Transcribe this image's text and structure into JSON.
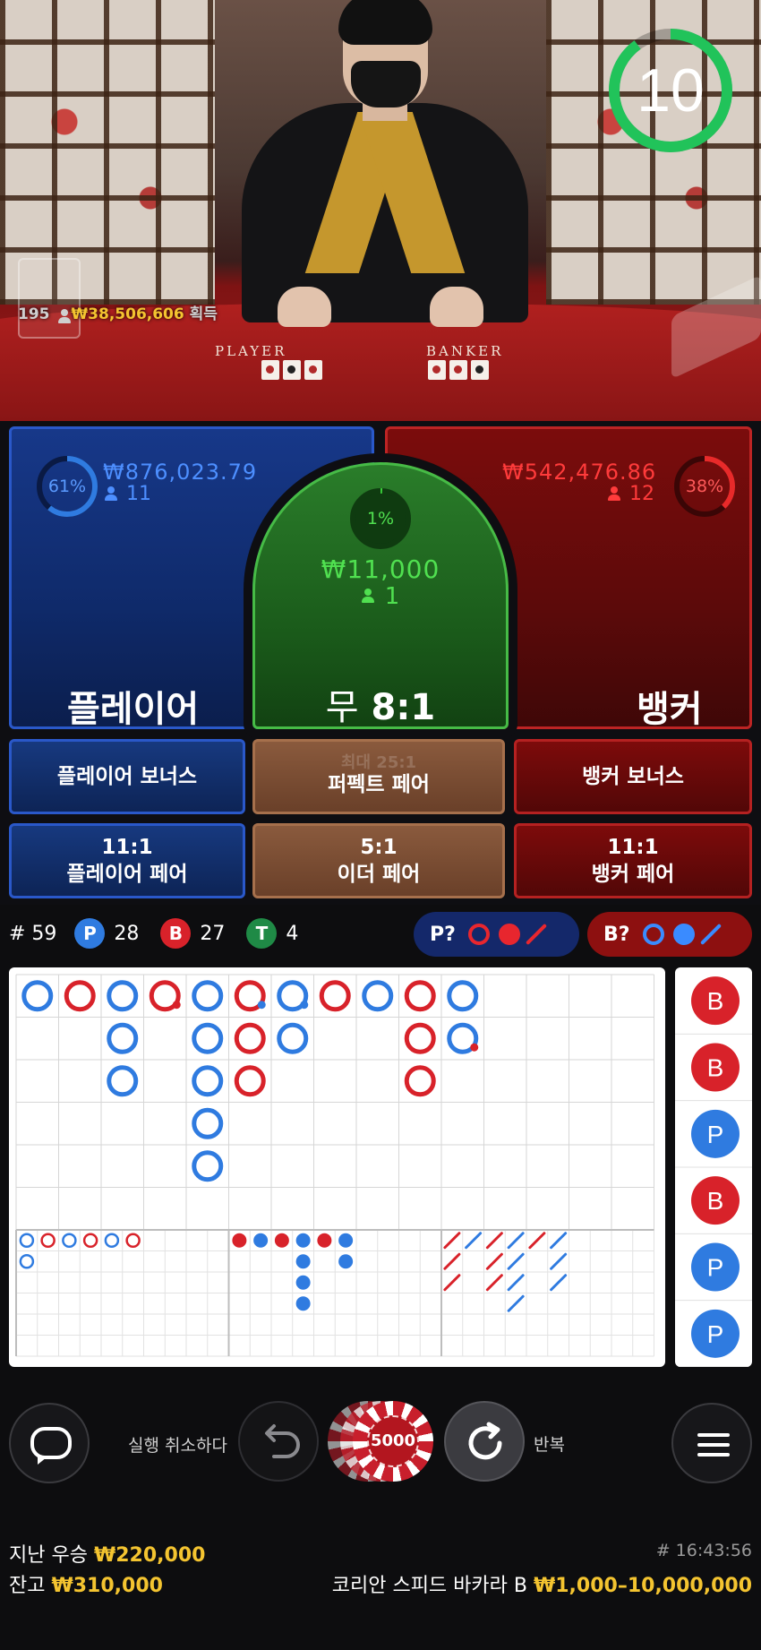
{
  "video": {
    "table_labels": {
      "player": "PLAYER",
      "banker": "BANKER"
    },
    "winners_count": "195",
    "winnings": "₩38,506,606",
    "winnings_suffix": "획득",
    "timer": "10",
    "timer_fraction": 0.9
  },
  "bets": {
    "player": {
      "percent": "61%",
      "percent_value": 0.61,
      "amount": "₩876,023.79",
      "count": "11",
      "label": "플레이어"
    },
    "banker": {
      "percent": "38%",
      "percent_value": 0.38,
      "amount": "₩542,476.86",
      "count": "12",
      "label": "뱅커"
    },
    "tie": {
      "percent": "1%",
      "percent_value": 0.01,
      "amount": "₩11,000",
      "count": "1",
      "label": "무",
      "odds": "8:1"
    }
  },
  "side_bets": {
    "player_bonus": "플레이어 보너스",
    "perfect_pair_odds": "최대 25:1",
    "perfect_pair": "퍼펙트 페어",
    "banker_bonus": "뱅커 보너스",
    "player_pair_odds": "11:1",
    "player_pair": "플레이어 페어",
    "either_pair_odds": "5:1",
    "either_pair": "이더 페어",
    "banker_pair_odds": "11:1",
    "banker_pair": "뱅커 페어"
  },
  "stats": {
    "round_label": "# 59",
    "player_badge": "P",
    "player_count": "28",
    "banker_badge": "B",
    "banker_count": "27",
    "tie_badge": "T",
    "tie_count": "4",
    "player_predict": "P?",
    "banker_predict": "B?"
  },
  "colors": {
    "player": "#2f7be0",
    "banker": "#d8222a",
    "tie": "#1f8a46",
    "gold": "#f4c430",
    "timer": "#21c35a"
  },
  "roadmap": {
    "big_road": [
      [
        "P"
      ],
      [
        "B"
      ],
      [
        "P",
        "P",
        "P"
      ],
      [
        "B"
      ],
      [
        "P",
        "P",
        "P",
        "P",
        "P"
      ],
      [
        "B",
        "B",
        "B"
      ],
      [
        "P",
        "P"
      ],
      [
        "B"
      ],
      [
        "P"
      ],
      [
        "B",
        "B",
        "B"
      ],
      [
        "P",
        "P"
      ]
    ],
    "big_road_marks": [
      {
        "col": 3,
        "row": 0,
        "mark": "banker-dot"
      },
      {
        "col": 5,
        "row": 0,
        "mark": "player-dot"
      },
      {
        "col": 6,
        "row": 0,
        "mark": "player-dot"
      },
      {
        "col": 10,
        "row": 1,
        "mark": "banker-dot"
      }
    ],
    "bead_side": [
      "B",
      "B",
      "P",
      "B",
      "P",
      "P"
    ]
  },
  "controls": {
    "undo_label": "실행 취소하다",
    "chip_value": "5000",
    "repeat_label": "반복",
    "icons": [
      "chat-icon",
      "undo-icon",
      "repeat-icon",
      "menu-icon"
    ]
  },
  "footer": {
    "last_win_label": "지난 우승",
    "last_win": "₩220,000",
    "balance_label": "잔고",
    "balance": "₩310,000",
    "round_id": "# 16:43:56",
    "table_name": "코리안 스피드 바카라 B",
    "limits": "₩1,000–10,000,000"
  }
}
